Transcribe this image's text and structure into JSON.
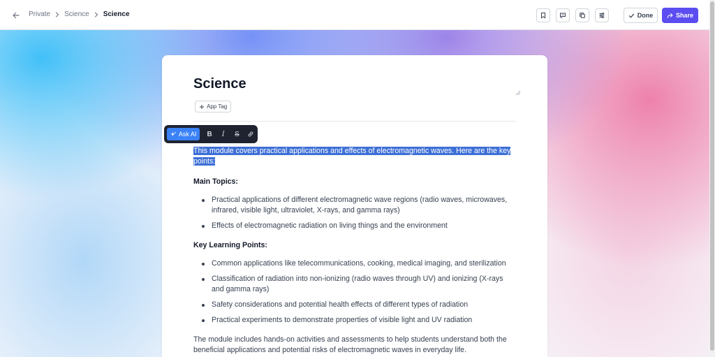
{
  "breadcrumb": {
    "items": [
      "Private",
      "Science",
      "Science"
    ]
  },
  "toolbar": {
    "icons": [
      "bookmark-icon",
      "comment-icon",
      "copy-icon",
      "sliders-icon"
    ],
    "done_label": "Done",
    "share_label": "Share"
  },
  "document": {
    "title": "Science",
    "app_tag_label": "App Tag",
    "format_bar": {
      "ask_ai_label": "Ask AI",
      "bold": "B",
      "italic": "I",
      "strike": "S"
    },
    "intro": "This module covers practical applications and effects of electromagnetic waves. Here are the key points:",
    "sections": [
      {
        "heading": "Main Topics:",
        "items": [
          "Practical applications of different electromagnetic wave regions (radio waves, microwaves, infrared, visible light, ultraviolet, X-rays, and gamma rays)",
          "Effects of electromagnetic radiation on living things and the environment"
        ]
      },
      {
        "heading": "Key Learning Points:",
        "items": [
          "Common applications like telecommunications, cooking, medical imaging, and sterilization",
          "Classification of radiation into non-ionizing (radio waves through UV) and ionizing (X-rays and gamma rays)",
          "Safety considerations and potential health effects of different types of radiation",
          "Practical experiments to demonstrate properties of visible light and UV radiation"
        ]
      }
    ],
    "outro": "The module includes hands-on activities and assessments to help students understand both the beneficial applications and potential risks of electromagnetic waves in everyday life."
  },
  "colors": {
    "accent": "#5b4df0",
    "selection": "#3d6fd6",
    "ask_ai": "#3b82f6",
    "format_bar": "#1f2330"
  }
}
